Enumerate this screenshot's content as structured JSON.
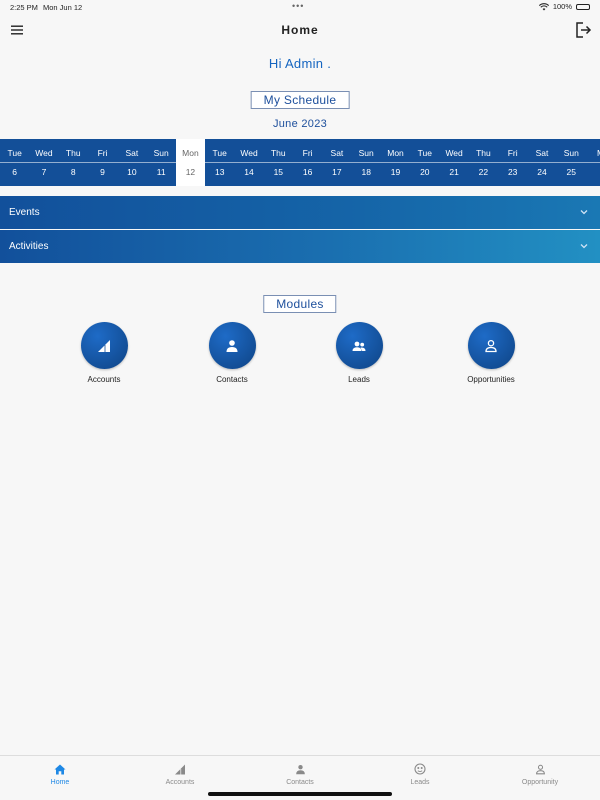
{
  "status_bar": {
    "time": "2:25 PM",
    "date": "Mon Jun 12",
    "dots": "•••",
    "battery": "100%"
  },
  "nav": {
    "title": "Home"
  },
  "greeting": "Hi Admin .",
  "schedule": {
    "title": "My Schedule",
    "month": "June 2023",
    "days": [
      {
        "name": "Tue",
        "date": "6",
        "selected": false
      },
      {
        "name": "Wed",
        "date": "7",
        "selected": false
      },
      {
        "name": "Thu",
        "date": "8",
        "selected": false
      },
      {
        "name": "Fri",
        "date": "9",
        "selected": false
      },
      {
        "name": "Sat",
        "date": "10",
        "selected": false
      },
      {
        "name": "Sun",
        "date": "11",
        "selected": false
      },
      {
        "name": "Mon",
        "date": "12",
        "selected": true
      },
      {
        "name": "Tue",
        "date": "13",
        "selected": false
      },
      {
        "name": "Wed",
        "date": "14",
        "selected": false
      },
      {
        "name": "Thu",
        "date": "15",
        "selected": false
      },
      {
        "name": "Fri",
        "date": "16",
        "selected": false
      },
      {
        "name": "Sat",
        "date": "17",
        "selected": false
      },
      {
        "name": "Sun",
        "date": "18",
        "selected": false
      },
      {
        "name": "Mon",
        "date": "19",
        "selected": false
      },
      {
        "name": "Tue",
        "date": "20",
        "selected": false
      },
      {
        "name": "Wed",
        "date": "21",
        "selected": false
      },
      {
        "name": "Thu",
        "date": "22",
        "selected": false
      },
      {
        "name": "Fri",
        "date": "23",
        "selected": false
      },
      {
        "name": "Sat",
        "date": "24",
        "selected": false
      },
      {
        "name": "Sun",
        "date": "25",
        "selected": false
      },
      {
        "name": "M",
        "date": "",
        "selected": false
      }
    ]
  },
  "sections": {
    "events": "Events",
    "activities": "Activities"
  },
  "modules": {
    "title": "Modules",
    "items": [
      {
        "label": "Accounts",
        "icon": "signal-icon"
      },
      {
        "label": "Contacts",
        "icon": "person-icon"
      },
      {
        "label": "Leads",
        "icon": "people-icon"
      },
      {
        "label": "Opportunities",
        "icon": "person-outline-icon"
      }
    ]
  },
  "tabs": [
    {
      "label": "Home",
      "icon": "home-icon",
      "active": true
    },
    {
      "label": "Accounts",
      "icon": "signal-icon",
      "active": false
    },
    {
      "label": "Contacts",
      "icon": "person-icon",
      "active": false
    },
    {
      "label": "Leads",
      "icon": "leads-icon",
      "active": false
    },
    {
      "label": "Opportunity",
      "icon": "person-outline-icon",
      "active": false
    }
  ],
  "colors": {
    "primary": "#134f98",
    "accent": "#1565c0",
    "active_tab": "#1e88e5"
  }
}
